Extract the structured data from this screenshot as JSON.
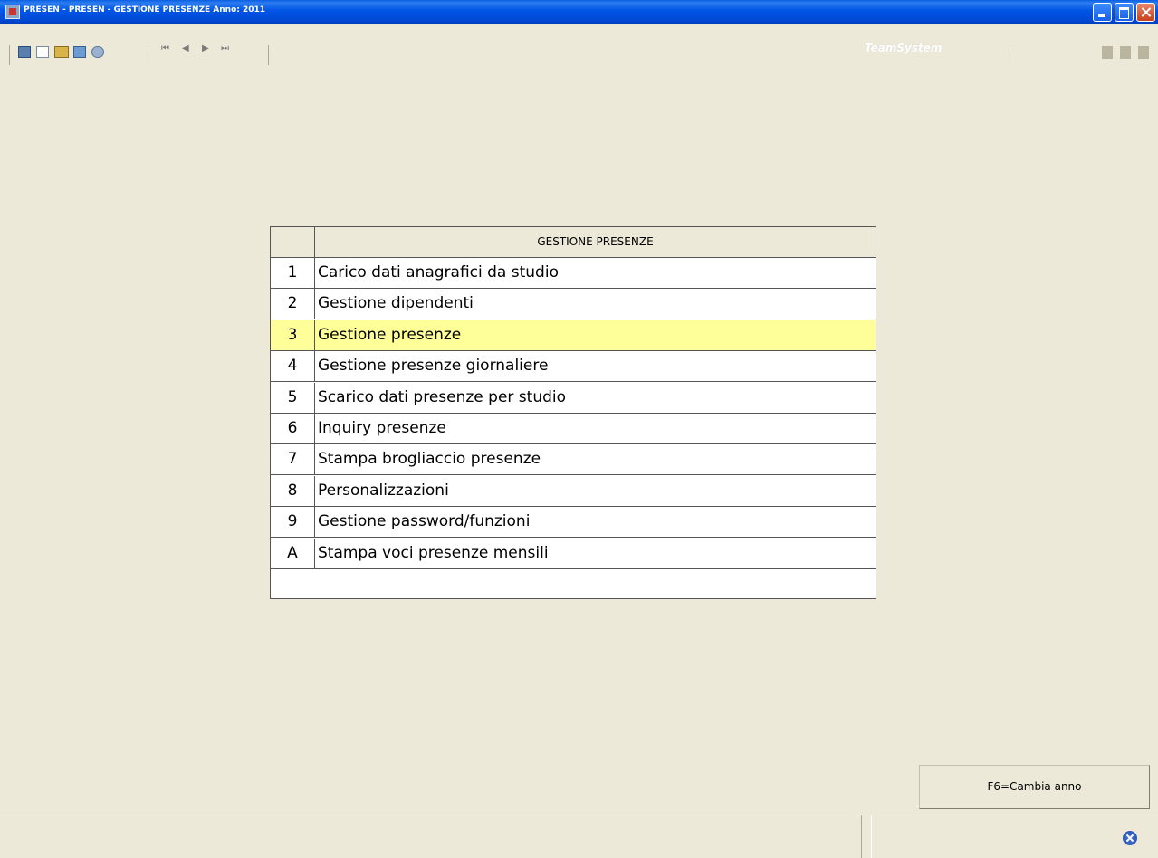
{
  "window": {
    "title": "PRESEN - PRESEN - GESTIONE PRESENZE Anno: 2011"
  },
  "toolbar": {
    "nav_first": "⏮",
    "nav_prev": "◀",
    "nav_next": "▶",
    "nav_last": "⏭",
    "brand": "TeamSystem"
  },
  "menu": {
    "header": "GESTIONE PRESENZE",
    "selected_key": "3",
    "items": [
      {
        "key": "1",
        "label": "Carico dati anagrafici da studio"
      },
      {
        "key": "2",
        "label": "Gestione dipendenti"
      },
      {
        "key": "3",
        "label": "Gestione presenze"
      },
      {
        "key": "4",
        "label": "Gestione presenze giornaliere"
      },
      {
        "key": "5",
        "label": "Scarico dati presenze per studio"
      },
      {
        "key": "6",
        "label": "Inquiry presenze"
      },
      {
        "key": "7",
        "label": "Stampa brogliaccio presenze"
      },
      {
        "key": "8",
        "label": "Personalizzazioni"
      },
      {
        "key": "9",
        "label": "Gestione password/funzioni"
      },
      {
        "key": "A",
        "label": "Stampa voci presenze mensili"
      }
    ]
  },
  "actions": {
    "change_year": "F6=Cambia anno"
  },
  "colors": {
    "selected_row": "#ffff99",
    "background": "#ece9d8"
  }
}
